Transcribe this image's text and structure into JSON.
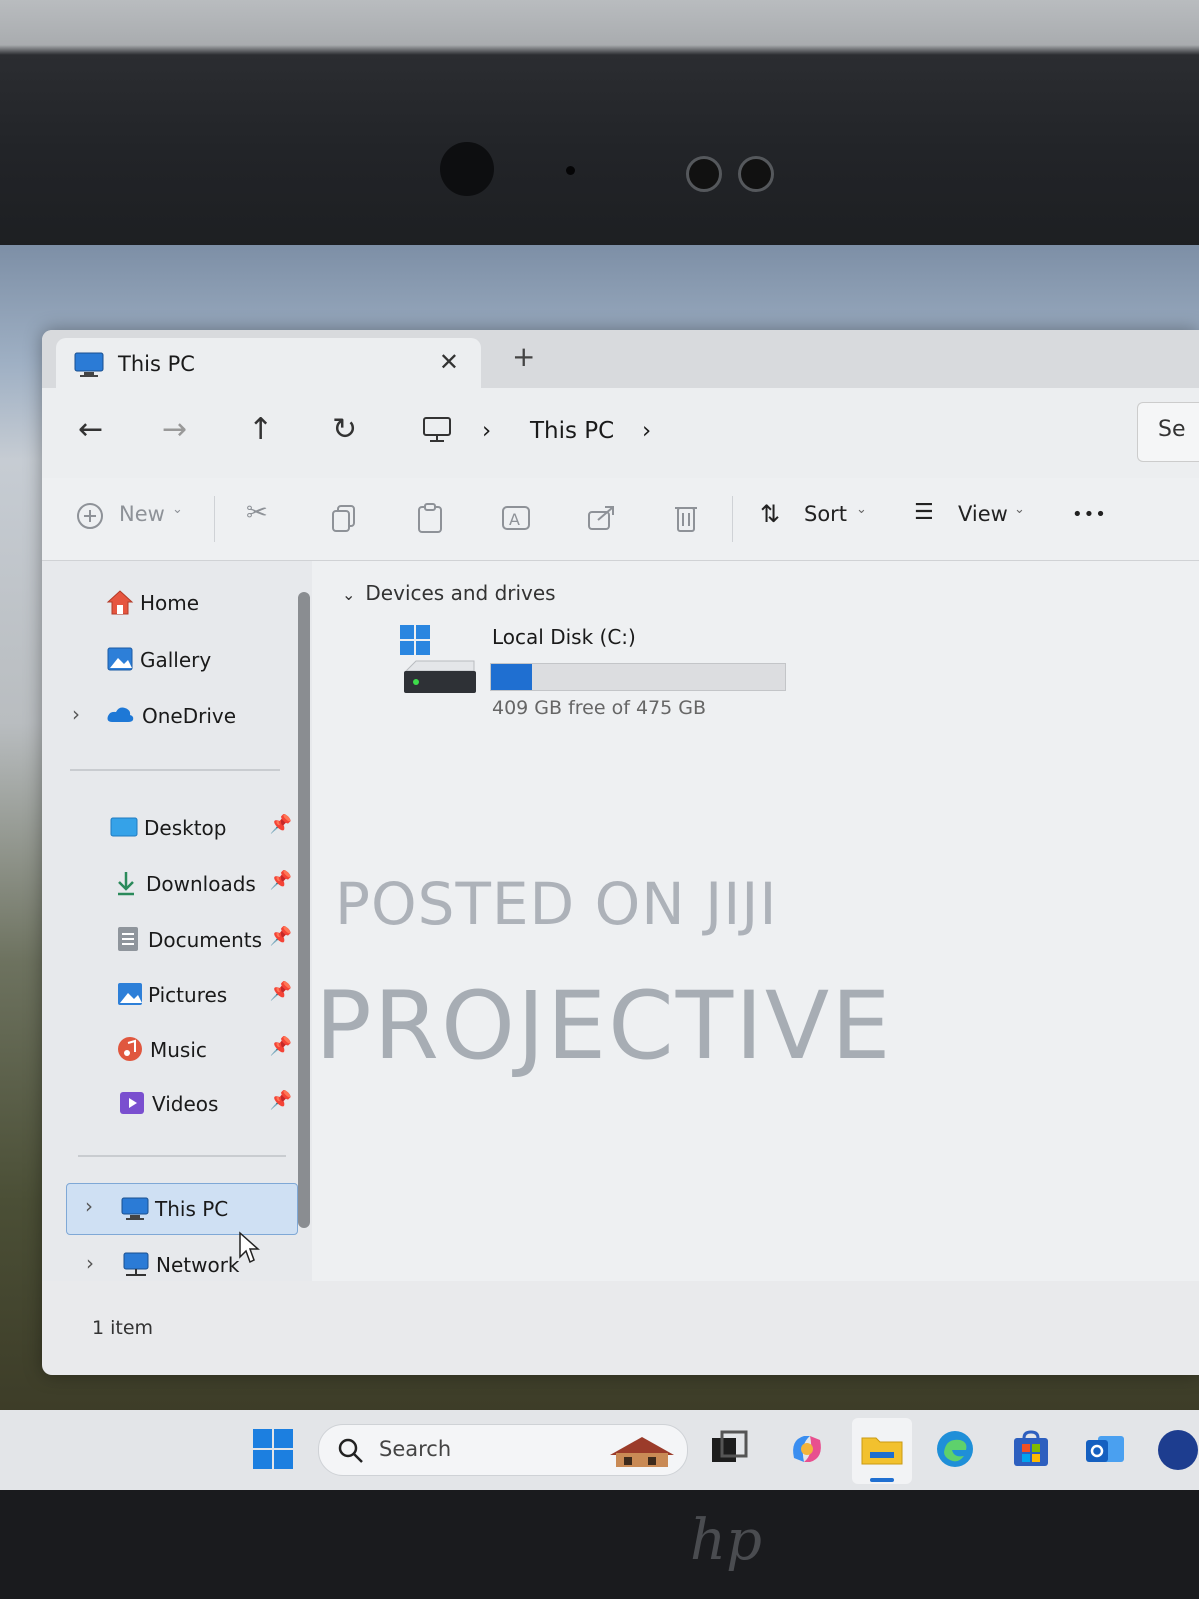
{
  "window": {
    "tab_title": "This PC",
    "tab_close": "✕",
    "tab_new": "+"
  },
  "nav": {
    "back": "←",
    "forward": "→",
    "up": "↑",
    "refresh": "↻",
    "crumb_sep1": "›",
    "crumb_location": "This PC",
    "crumb_sep2": "›",
    "search_fragment": "Se"
  },
  "toolbar": {
    "new_label": "New",
    "sort_label": "Sort",
    "view_label": "View",
    "more": "•••"
  },
  "sidebar": {
    "items": [
      {
        "label": "Home"
      },
      {
        "label": "Gallery"
      },
      {
        "label": "OneDrive"
      },
      {
        "label": "Desktop"
      },
      {
        "label": "Downloads"
      },
      {
        "label": "Documents"
      },
      {
        "label": "Pictures"
      },
      {
        "label": "Music"
      },
      {
        "label": "Videos"
      },
      {
        "label": "This PC"
      },
      {
        "label": "Network"
      }
    ]
  },
  "content": {
    "group_header": "Devices and drives",
    "drive": {
      "name": "Local Disk (C:)",
      "free_text": "409 GB free of 475 GB",
      "used_fraction": 0.139
    }
  },
  "watermark": {
    "line1": "POSTED ON JIJI",
    "line2": "PROJECTIVE"
  },
  "status": {
    "items": "1 item"
  },
  "taskbar": {
    "search_label": "Search"
  },
  "brand": {
    "logo": "hp"
  },
  "colors": {
    "accent": "#1f6fd1",
    "selection": "#cfe0f3"
  }
}
